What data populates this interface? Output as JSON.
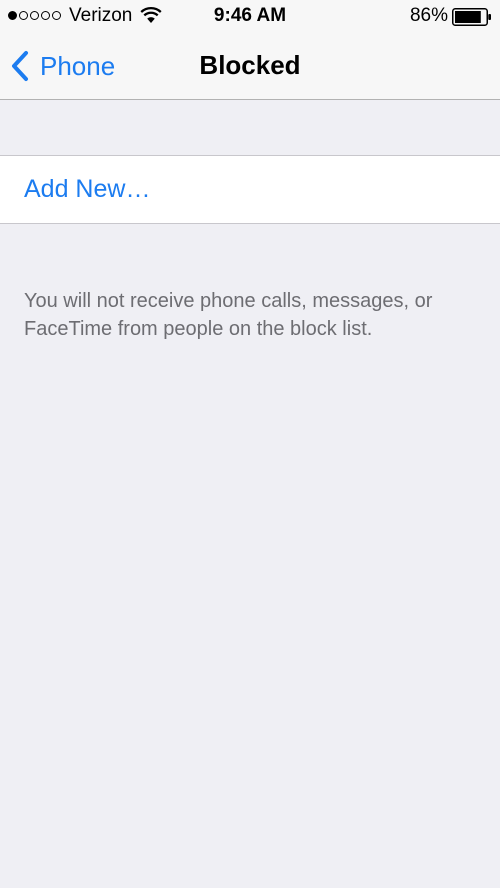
{
  "status_bar": {
    "signal_filled": 1,
    "signal_total": 5,
    "carrier": "Verizon",
    "wifi_icon": "wifi-icon",
    "time": "9:46 AM",
    "battery_percent": "86%",
    "battery_level": 0.86,
    "battery_icon": "battery-icon"
  },
  "nav": {
    "back_icon": "chevron-left-icon",
    "back_label": "Phone",
    "title": "Blocked"
  },
  "list": {
    "add_label": "Add New…"
  },
  "footer": {
    "text": "You will not receive phone calls, messages, or FaceTime from people on the block list."
  },
  "colors": {
    "accent": "#1c7cf0",
    "background": "#efeff4",
    "footer_text": "#6d6d72"
  }
}
